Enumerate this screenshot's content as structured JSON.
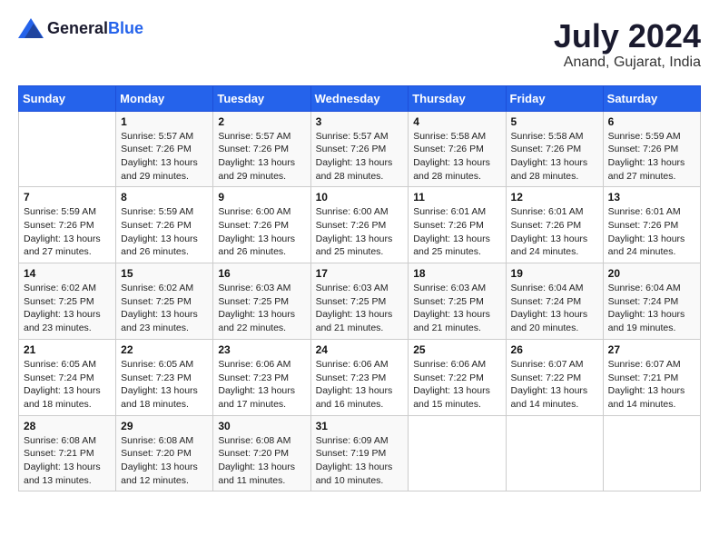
{
  "logo": {
    "text_general": "General",
    "text_blue": "Blue"
  },
  "title": {
    "month_year": "July 2024",
    "location": "Anand, Gujarat, India"
  },
  "weekdays": [
    "Sunday",
    "Monday",
    "Tuesday",
    "Wednesday",
    "Thursday",
    "Friday",
    "Saturday"
  ],
  "weeks": [
    [
      {
        "day": "",
        "info": ""
      },
      {
        "day": "1",
        "info": "Sunrise: 5:57 AM\nSunset: 7:26 PM\nDaylight: 13 hours\nand 29 minutes."
      },
      {
        "day": "2",
        "info": "Sunrise: 5:57 AM\nSunset: 7:26 PM\nDaylight: 13 hours\nand 29 minutes."
      },
      {
        "day": "3",
        "info": "Sunrise: 5:57 AM\nSunset: 7:26 PM\nDaylight: 13 hours\nand 28 minutes."
      },
      {
        "day": "4",
        "info": "Sunrise: 5:58 AM\nSunset: 7:26 PM\nDaylight: 13 hours\nand 28 minutes."
      },
      {
        "day": "5",
        "info": "Sunrise: 5:58 AM\nSunset: 7:26 PM\nDaylight: 13 hours\nand 28 minutes."
      },
      {
        "day": "6",
        "info": "Sunrise: 5:59 AM\nSunset: 7:26 PM\nDaylight: 13 hours\nand 27 minutes."
      }
    ],
    [
      {
        "day": "7",
        "info": "Sunrise: 5:59 AM\nSunset: 7:26 PM\nDaylight: 13 hours\nand 27 minutes."
      },
      {
        "day": "8",
        "info": "Sunrise: 5:59 AM\nSunset: 7:26 PM\nDaylight: 13 hours\nand 26 minutes."
      },
      {
        "day": "9",
        "info": "Sunrise: 6:00 AM\nSunset: 7:26 PM\nDaylight: 13 hours\nand 26 minutes."
      },
      {
        "day": "10",
        "info": "Sunrise: 6:00 AM\nSunset: 7:26 PM\nDaylight: 13 hours\nand 25 minutes."
      },
      {
        "day": "11",
        "info": "Sunrise: 6:01 AM\nSunset: 7:26 PM\nDaylight: 13 hours\nand 25 minutes."
      },
      {
        "day": "12",
        "info": "Sunrise: 6:01 AM\nSunset: 7:26 PM\nDaylight: 13 hours\nand 24 minutes."
      },
      {
        "day": "13",
        "info": "Sunrise: 6:01 AM\nSunset: 7:26 PM\nDaylight: 13 hours\nand 24 minutes."
      }
    ],
    [
      {
        "day": "14",
        "info": "Sunrise: 6:02 AM\nSunset: 7:25 PM\nDaylight: 13 hours\nand 23 minutes."
      },
      {
        "day": "15",
        "info": "Sunrise: 6:02 AM\nSunset: 7:25 PM\nDaylight: 13 hours\nand 23 minutes."
      },
      {
        "day": "16",
        "info": "Sunrise: 6:03 AM\nSunset: 7:25 PM\nDaylight: 13 hours\nand 22 minutes."
      },
      {
        "day": "17",
        "info": "Sunrise: 6:03 AM\nSunset: 7:25 PM\nDaylight: 13 hours\nand 21 minutes."
      },
      {
        "day": "18",
        "info": "Sunrise: 6:03 AM\nSunset: 7:25 PM\nDaylight: 13 hours\nand 21 minutes."
      },
      {
        "day": "19",
        "info": "Sunrise: 6:04 AM\nSunset: 7:24 PM\nDaylight: 13 hours\nand 20 minutes."
      },
      {
        "day": "20",
        "info": "Sunrise: 6:04 AM\nSunset: 7:24 PM\nDaylight: 13 hours\nand 19 minutes."
      }
    ],
    [
      {
        "day": "21",
        "info": "Sunrise: 6:05 AM\nSunset: 7:24 PM\nDaylight: 13 hours\nand 18 minutes."
      },
      {
        "day": "22",
        "info": "Sunrise: 6:05 AM\nSunset: 7:23 PM\nDaylight: 13 hours\nand 18 minutes."
      },
      {
        "day": "23",
        "info": "Sunrise: 6:06 AM\nSunset: 7:23 PM\nDaylight: 13 hours\nand 17 minutes."
      },
      {
        "day": "24",
        "info": "Sunrise: 6:06 AM\nSunset: 7:23 PM\nDaylight: 13 hours\nand 16 minutes."
      },
      {
        "day": "25",
        "info": "Sunrise: 6:06 AM\nSunset: 7:22 PM\nDaylight: 13 hours\nand 15 minutes."
      },
      {
        "day": "26",
        "info": "Sunrise: 6:07 AM\nSunset: 7:22 PM\nDaylight: 13 hours\nand 14 minutes."
      },
      {
        "day": "27",
        "info": "Sunrise: 6:07 AM\nSunset: 7:21 PM\nDaylight: 13 hours\nand 14 minutes."
      }
    ],
    [
      {
        "day": "28",
        "info": "Sunrise: 6:08 AM\nSunset: 7:21 PM\nDaylight: 13 hours\nand 13 minutes."
      },
      {
        "day": "29",
        "info": "Sunrise: 6:08 AM\nSunset: 7:20 PM\nDaylight: 13 hours\nand 12 minutes."
      },
      {
        "day": "30",
        "info": "Sunrise: 6:08 AM\nSunset: 7:20 PM\nDaylight: 13 hours\nand 11 minutes."
      },
      {
        "day": "31",
        "info": "Sunrise: 6:09 AM\nSunset: 7:19 PM\nDaylight: 13 hours\nand 10 minutes."
      },
      {
        "day": "",
        "info": ""
      },
      {
        "day": "",
        "info": ""
      },
      {
        "day": "",
        "info": ""
      }
    ]
  ]
}
